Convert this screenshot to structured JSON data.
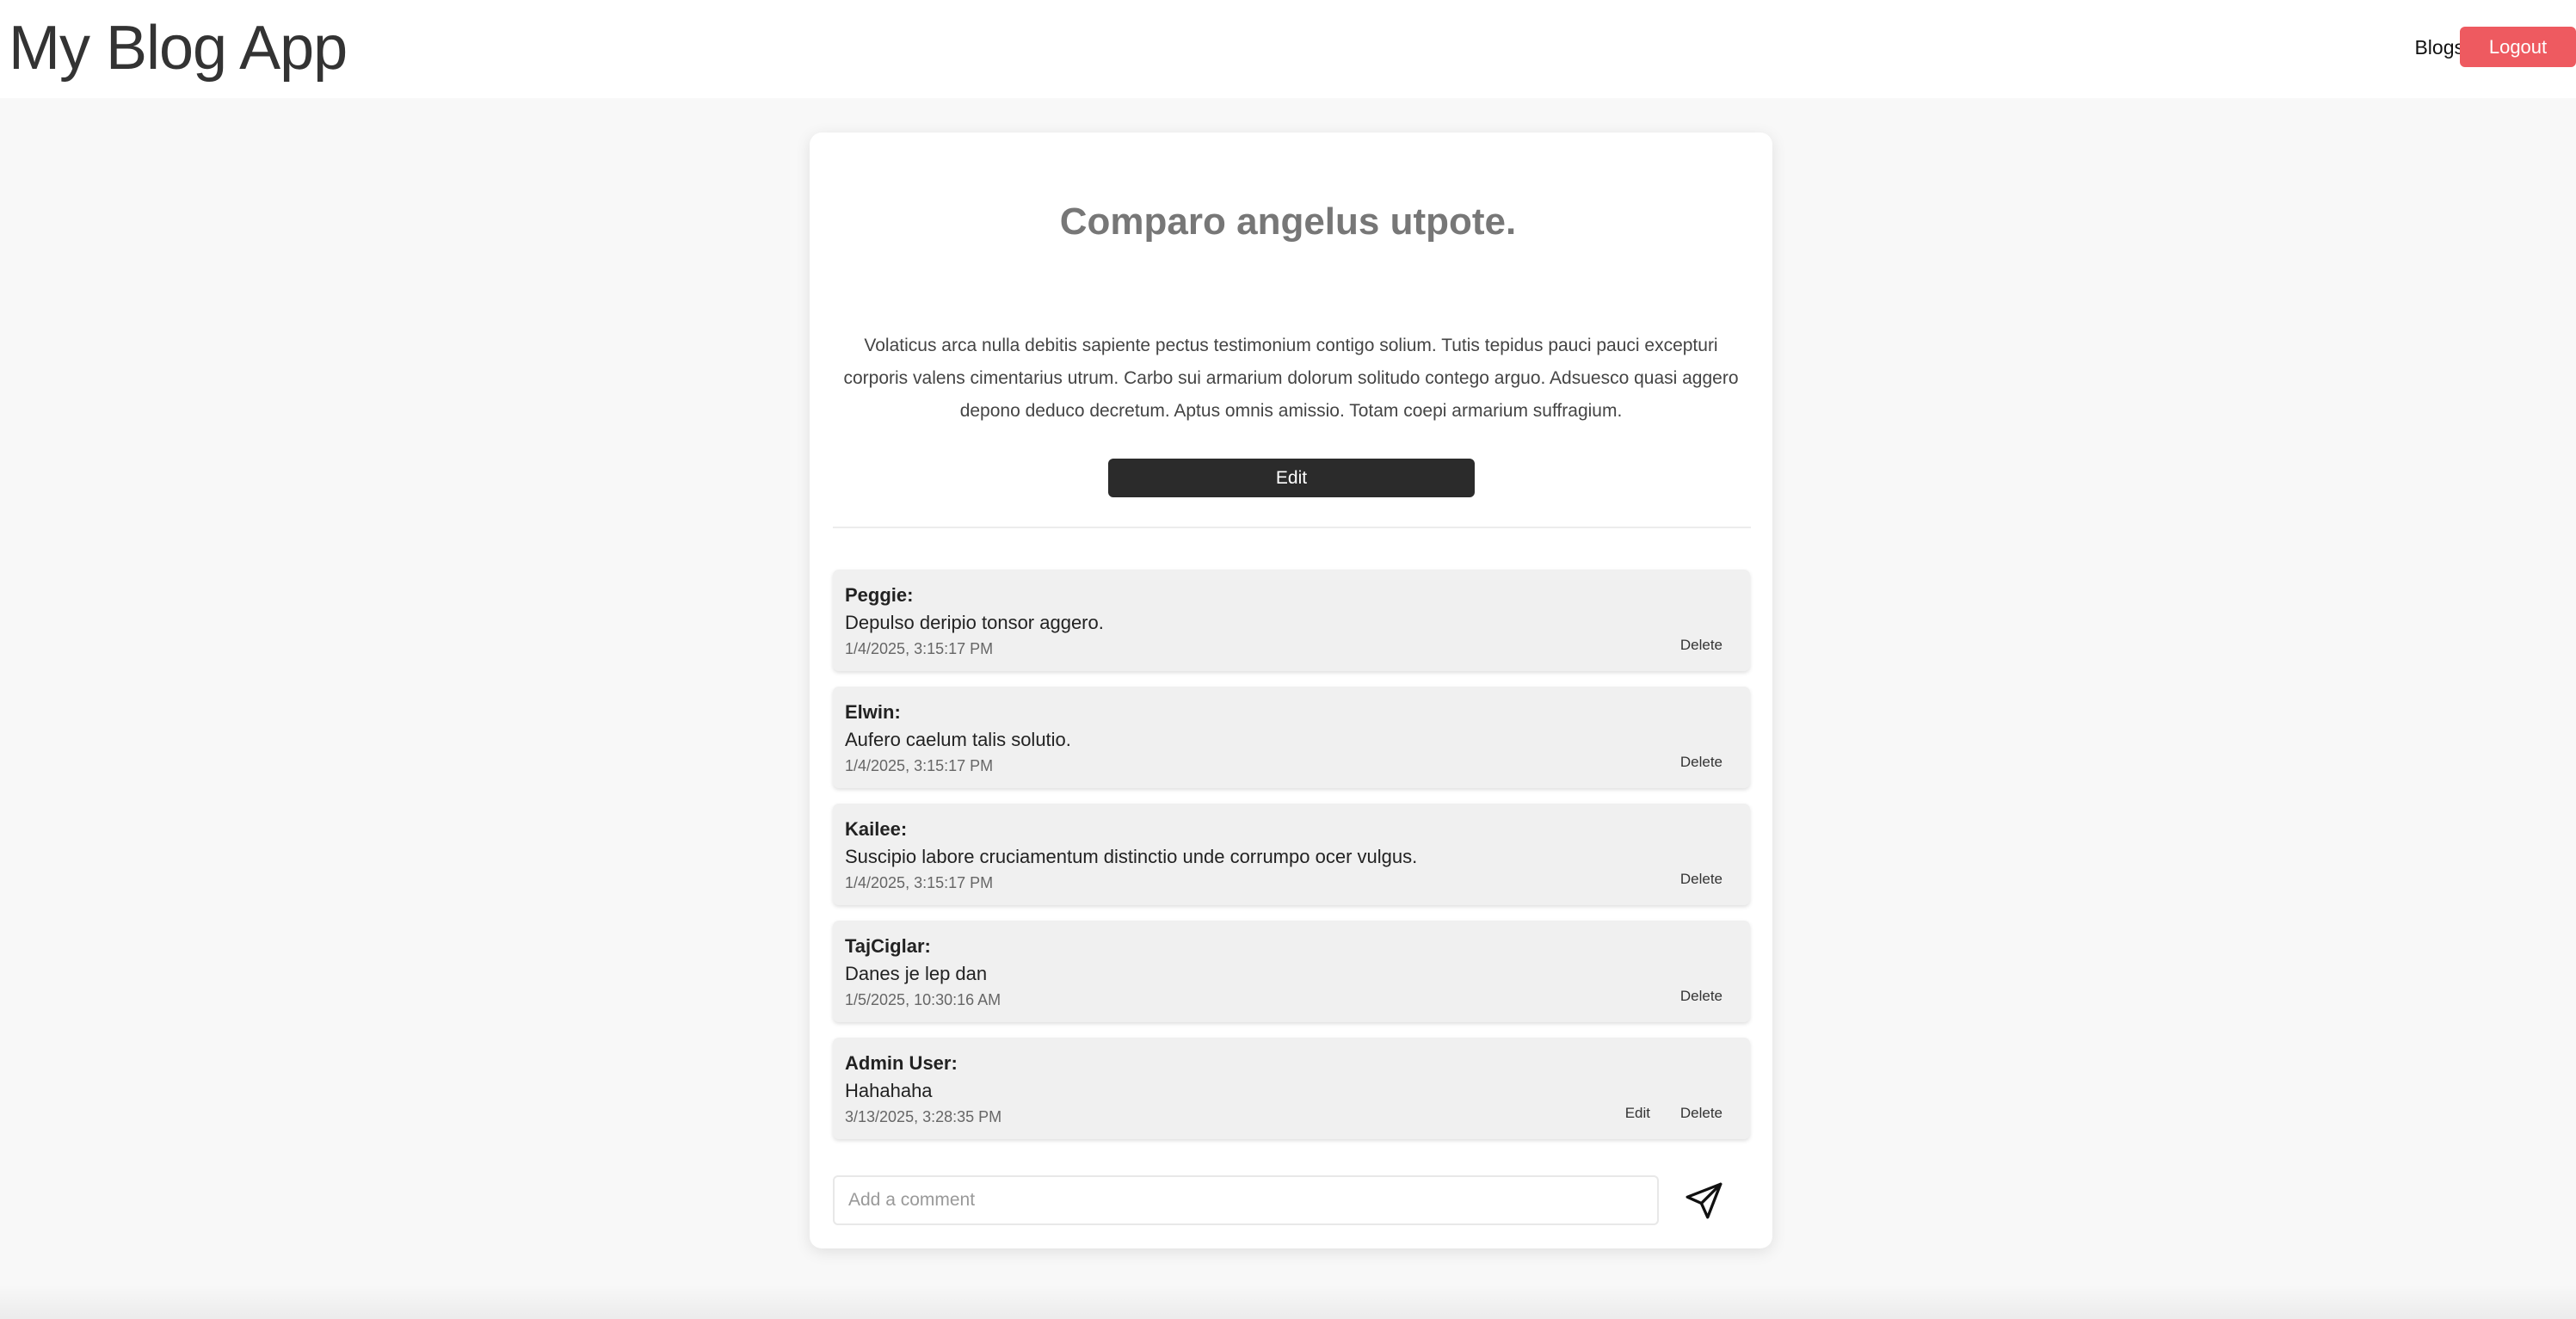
{
  "header": {
    "app_title": "My Blog App",
    "nav_blogs": "Blogs",
    "logout_label": "Logout"
  },
  "post": {
    "title": "Comparo angelus utpote.",
    "body": "Volaticus arca nulla debitis sapiente pectus testimonium contigo solium. Tutis tepidus pauci pauci excepturi corporis valens cimentarius utrum. Carbo sui armarium dolorum solitudo contego arguo. Adsuesco quasi aggero depono deduco decretum. Aptus omnis amissio. Totam coepi armarium suffragium.",
    "edit_label": "Edit"
  },
  "comments": [
    {
      "author": "Peggie:",
      "text": "Depulso deripio tonsor aggero.",
      "time": "1/4/2025, 3:15:17 PM",
      "delete_label": "Delete"
    },
    {
      "author": "Elwin:",
      "text": "Aufero caelum talis solutio.",
      "time": "1/4/2025, 3:15:17 PM",
      "delete_label": "Delete"
    },
    {
      "author": "Kailee:",
      "text": "Suscipio labore cruciamentum distinctio unde corrumpo ocer vulgus.",
      "time": "1/4/2025, 3:15:17 PM",
      "delete_label": "Delete"
    },
    {
      "author": "TajCiglar:",
      "text": "Danes je lep dan",
      "time": "1/5/2025, 10:30:16 AM",
      "delete_label": "Delete"
    },
    {
      "author": "Admin User:",
      "text": "Hahahaha",
      "time": "3/13/2025, 3:28:35 PM",
      "edit_label": "Edit",
      "delete_label": "Delete"
    }
  ],
  "comment_form": {
    "placeholder": "Add a comment",
    "value": "",
    "send_icon": "send-icon"
  },
  "colors": {
    "logout": "#ee5a60",
    "edit_button": "#2b2b2b",
    "background": "#f8f8f8"
  }
}
